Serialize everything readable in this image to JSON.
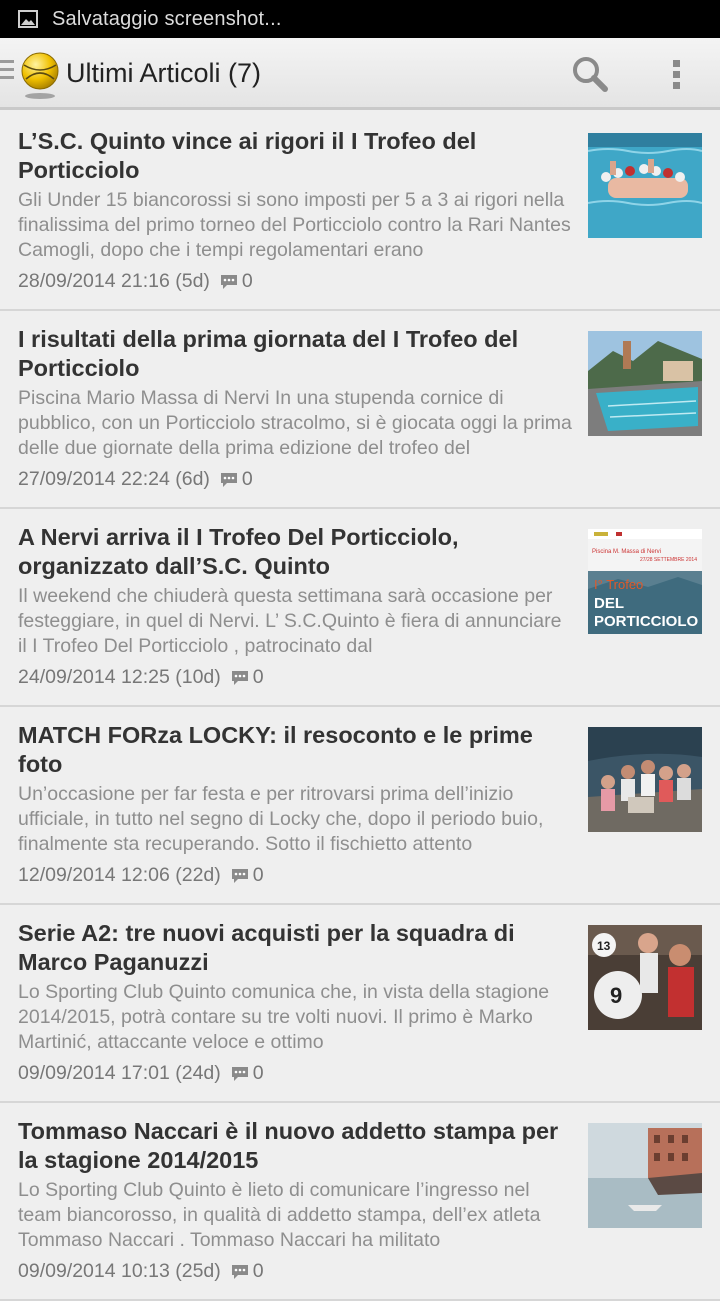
{
  "status_bar": {
    "notification": "Salvataggio screenshot..."
  },
  "action_bar": {
    "title": "Ultimi Articoli (7)",
    "icons": [
      "drawer-icon",
      "water-polo-ball-logo",
      "search-icon",
      "overflow-menu-icon"
    ]
  },
  "articles": [
    {
      "title": "L’S.C. Quinto vince ai rigori il I Trofeo del Porticciolo",
      "excerpt": "Gli Under 15 biancorossi si sono imposti per 5 a 3 ai rigori nella finalissima del primo torneo del Porticciolo contro la Rari Nantes Camogli, dopo che i tempi regolamentari erano",
      "date": "28/09/2014 21:16 (5d)",
      "comments": "0"
    },
    {
      "title": "I risultati della prima giornata del I Trofeo del Porticciolo",
      "excerpt": "Piscina Mario Massa di Nervi In una stupenda cornice di pubblico, con un Porticciolo stracolmo, si è giocata oggi la prima delle due giornate della prima edizione del trofeo del",
      "date": "27/09/2014 22:24 (6d)",
      "comments": "0"
    },
    {
      "title": "A Nervi arriva il I Trofeo Del Porticciolo, organizzato dall’S.C. Quinto",
      "excerpt": "Il weekend che chiuderà questa settimana sarà occasione per festeggiare, in quel di Nervi. L’ S.C.Quinto è fiera di annunciare il I Trofeo Del Porticciolo , patrocinato dal",
      "date": "24/09/2014 12:25 (10d)",
      "comments": "0",
      "poster": {
        "line1": "Piscina M. Massa di Nervi",
        "line2": "27/28 SETTEMBRE 2014",
        "line3": "I° Trofeo",
        "line4": "DEL",
        "line5": "PORTICCIOLO"
      }
    },
    {
      "title": "MATCH FORza LOCKY: il resoconto e le prime foto",
      "excerpt": "Un’occasione per far festa e per ritrovarsi prima dell’inizio ufficiale, in tutto nel segno di Locky che, dopo il periodo buio, finalmente sta recuperando. Sotto il fischietto attento",
      "date": "12/09/2014 12:06 (22d)",
      "comments": "0"
    },
    {
      "title": "Serie A2: tre nuovi acquisti per la squadra di Marco Paganuzzi",
      "excerpt": "Lo Sporting Club Quinto comunica che, in vista della stagione 2014/2015, potrà contare su tre volti nuovi. Il primo è  Marko Martinić,  attaccante veloce e ottimo",
      "date": "09/09/2014 17:01 (24d)",
      "comments": "0",
      "caps": [
        "13",
        "9"
      ]
    },
    {
      "title": "Tommaso Naccari è il nuovo addetto stampa per la stagione 2014/2015",
      "excerpt": "Lo Sporting Club Quinto è lieto di comunicare l’ingresso nel team biancorosso, in qualità di addetto stampa, dell’ex atleta Tommaso Naccari . Tommaso Naccari ha militato",
      "date": "09/09/2014 10:13 (25d)",
      "comments": "0"
    }
  ]
}
